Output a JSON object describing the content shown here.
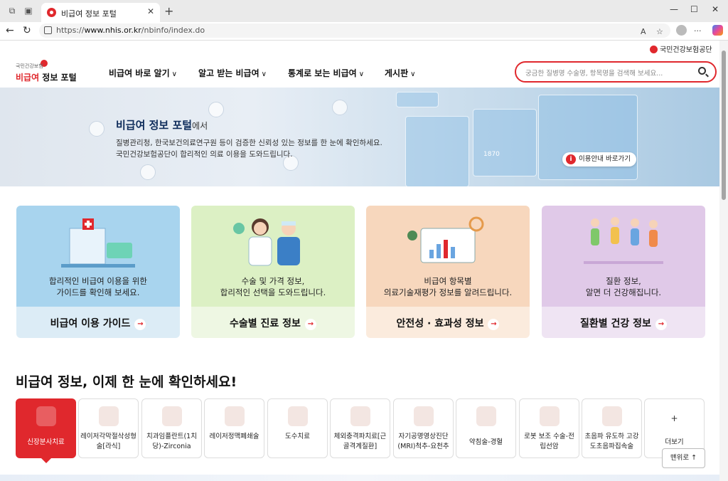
{
  "browser": {
    "tab_title": "비급여 정보 포털",
    "url_prefix": "https://",
    "url_domain": "www.nhis.or.kr",
    "url_path": "/nbinfo/index.do",
    "read_aloud": "A",
    "more": "···"
  },
  "site": {
    "org_name": "국민건강보험공단",
    "logo_small": "국민건강보험",
    "logo_brand": "비급여",
    "logo_rest": " 정보 포털"
  },
  "nav": {
    "items": [
      {
        "label": "비급여 바로 알기"
      },
      {
        "label": "알고 받는 비급여"
      },
      {
        "label": "통계로 보는 비급여"
      },
      {
        "label": "게시판"
      }
    ],
    "search_placeholder": "궁금한 질병명 수술명, 항목명을 검색해 보세요..."
  },
  "banner": {
    "title": "비급여 정보 포털",
    "title_suffix": "에서",
    "line1": "질병관리청, 한국보건의료연구원 등이 검증한 신뢰성 있는 정보를 한 눈에 확인하세요.",
    "line2": "국민건강보험공단이 합리적인 의료 이용을 도와드립니다.",
    "guide_button": "이용안내 바로가기",
    "screen_number": "1870"
  },
  "cards": [
    {
      "desc1": "합리적인 비급여 이용을 위한",
      "desc2": "가이드를 확인해 보세요.",
      "title": "비급여 이용 가이드",
      "top_color": "#a8d4ee",
      "bottom_color": "#dcecf6"
    },
    {
      "desc1": "수술 및 가격 정보,",
      "desc2": "합리적인 선택을 도와드립니다.",
      "title": "수술별 진료 정보",
      "top_color": "#dcf0c4",
      "bottom_color": "#eef7e3"
    },
    {
      "desc1": "비급여 항목별",
      "desc2": "의료기술재평가 정보를 알려드립니다.",
      "title": "안전성 · 효과성 정보",
      "top_color": "#f7d7bd",
      "bottom_color": "#fbebdd"
    },
    {
      "desc1": "질환 정보,",
      "desc2": "알면 더 건강해집니다.",
      "title": "질환별 건강 정보",
      "top_color": "#e0c9e8",
      "bottom_color": "#efe4f3"
    }
  ],
  "section": {
    "title": "비급여 정보, 이제 한 눈에 확인하세요!",
    "categories": [
      {
        "label": "신장분사치료",
        "icon": "joint-icon"
      },
      {
        "label": "레이저각막절삭성형술[라식]",
        "icon": "eye-icon"
      },
      {
        "label": "치과임플란트(1치당)-Zirconia",
        "icon": "tooth-implant-icon"
      },
      {
        "label": "레이저정맥폐쇄술",
        "icon": "leg-vein-icon"
      },
      {
        "label": "도수치료",
        "icon": "spine-icon"
      },
      {
        "label": "체외충격파치료[근골격계질환]",
        "icon": "shockwave-device-icon"
      },
      {
        "label": "자기공명영상진단(MRI)척추-요천추",
        "icon": "mri-icon"
      },
      {
        "label": "약침술-경혈",
        "icon": "acupuncture-icon"
      },
      {
        "label": "로봇 보조 수술-전립선암",
        "icon": "robot-arm-icon"
      },
      {
        "label": "초음파 유도하 고강도초음파집속술",
        "icon": "uterus-icon"
      },
      {
        "label": "더보기",
        "icon": "plus-icon"
      }
    ],
    "more_plus": "+",
    "top_button": "맨위로 ↑"
  }
}
